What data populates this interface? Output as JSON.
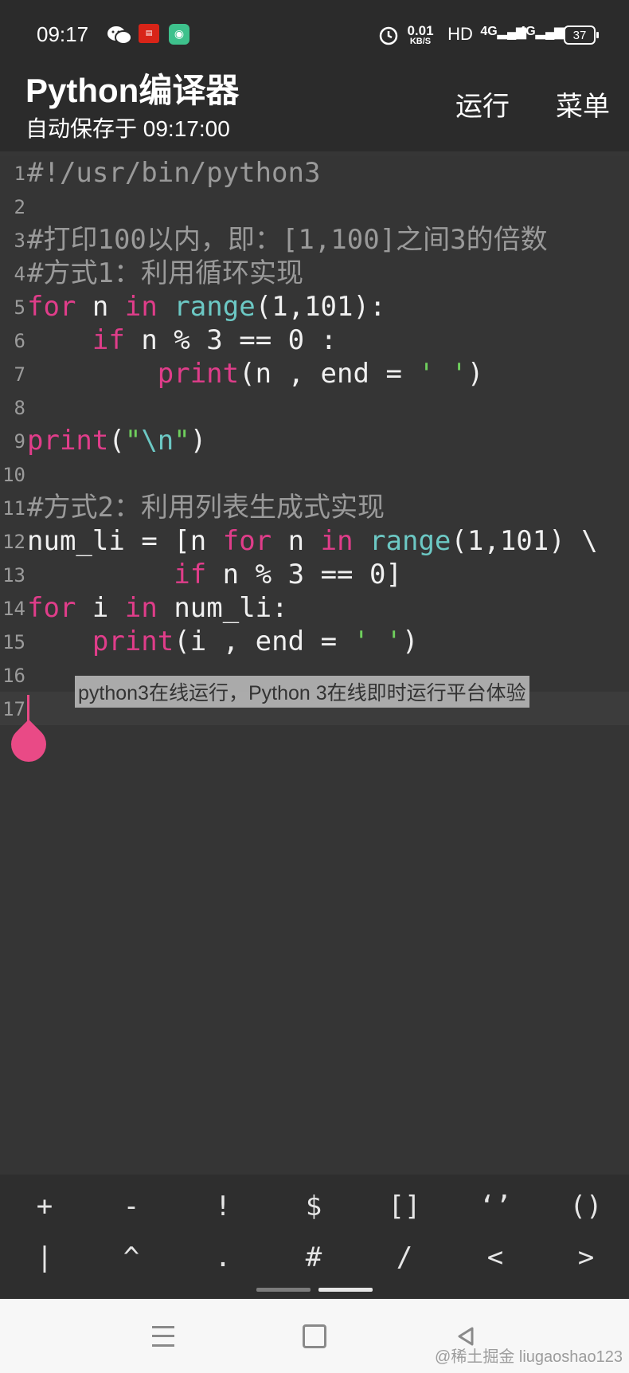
{
  "status_bar": {
    "time": "09:17",
    "net_speed_value": "0.01",
    "net_speed_unit": "KB/S",
    "hd": "HD",
    "signal1": "4G",
    "signal2": "4G",
    "battery": "37",
    "icons": [
      "wechat-icon",
      "app-icon",
      "app-icon",
      "alarm-icon",
      "signal-icon",
      "battery-icon"
    ]
  },
  "app_bar": {
    "title": "Python编译器",
    "autosave": "自动保存于 09:17:00",
    "run_label": "运行",
    "menu_label": "菜单"
  },
  "editor": {
    "lines": [
      {
        "num": "1",
        "text": "#!/usr/bin/python3"
      },
      {
        "num": "2",
        "text": ""
      },
      {
        "num": "3",
        "text": "#打印100以内，即：[1,100]之间3的倍数"
      },
      {
        "num": "4",
        "text": "#方式1：利用循环实现"
      },
      {
        "num": "5",
        "text": "for n in range(1,101):"
      },
      {
        "num": "6",
        "text": "    if n % 3 == 0 :"
      },
      {
        "num": "7",
        "text": "        print(n , end = ' ')"
      },
      {
        "num": "8",
        "text": ""
      },
      {
        "num": "9",
        "text": "print(\"\\n\")"
      },
      {
        "num": "10",
        "text": ""
      },
      {
        "num": "11",
        "text": "#方式2：利用列表生成式实现"
      },
      {
        "num": "12",
        "text": "num_li = [n for n in range(1,101) \\"
      },
      {
        "num": "13",
        "text": "         if n % 3 == 0]"
      },
      {
        "num": "14",
        "text": "for i in num_li:"
      },
      {
        "num": "15",
        "text": "    print(i , end = ' ')"
      },
      {
        "num": "16",
        "text": ""
      },
      {
        "num": "17",
        "text": ""
      }
    ],
    "overlay_caption": "python3在线运行，Python 3在线即时运行平台体验"
  },
  "symbol_keys": {
    "row1": [
      "+",
      "-",
      "!",
      "$",
      "[]",
      "‘’",
      "()"
    ],
    "row2": [
      "|",
      "^",
      ".",
      "#",
      "/",
      "<",
      ">"
    ]
  },
  "nav_bar": {
    "watermark": "@稀土掘金 liugaoshao123"
  },
  "colors": {
    "background": "#363636",
    "keyword": "#e03d8a",
    "builtin": "#6cc8c4",
    "string": "#6fcf5d",
    "comment": "#9a9a9a",
    "cursor": "#e94a86"
  }
}
